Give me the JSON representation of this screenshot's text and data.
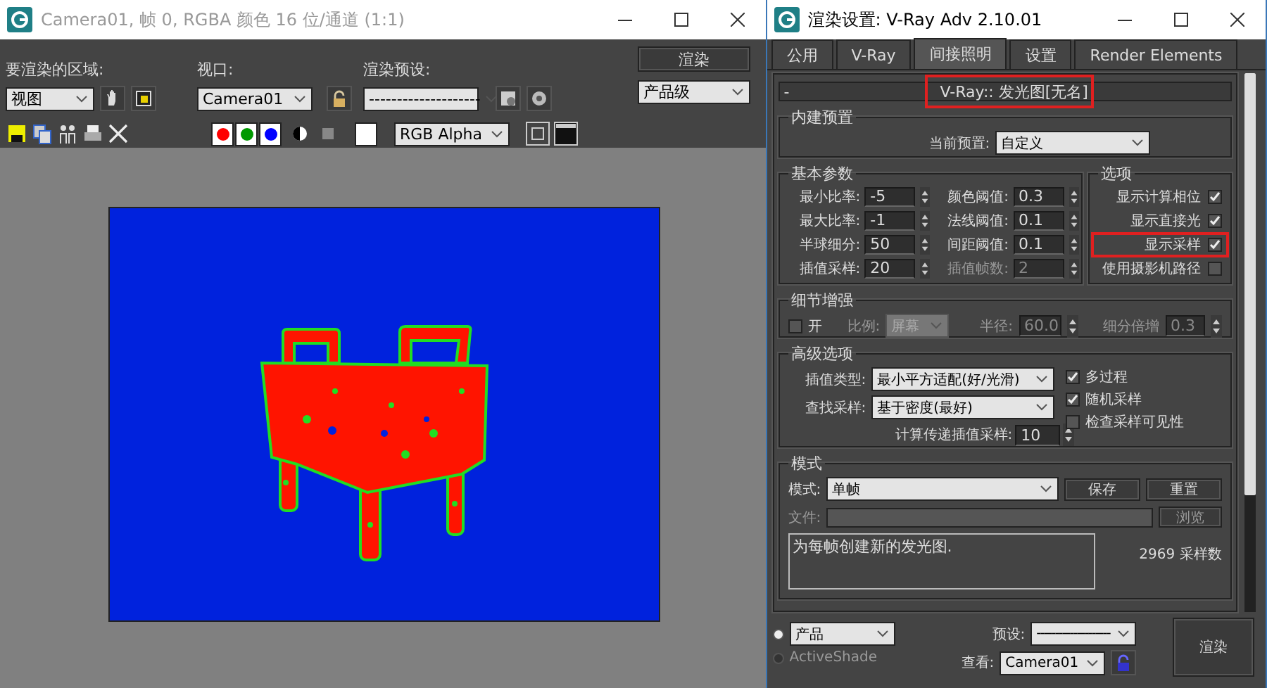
{
  "render_window": {
    "title": "Camera01, 帧 0, RGBA 颜色 16 位/通道 (1:1)",
    "area_label": "要渲染的区域:",
    "area_value": "视图",
    "viewport_label": "视口:",
    "viewport_value": "Camera01",
    "preset_label": "渲染预设:",
    "preset_value": "--------------------",
    "render_button": "渲染",
    "quality_value": "产品级",
    "channels": [
      {
        "color": "#ff0000"
      },
      {
        "color": "#009900"
      },
      {
        "color": "#0000ff"
      }
    ],
    "display_channel": "RGB Alpha"
  },
  "settings_window": {
    "title": "渲染设置: V-Ray Adv 2.10.01",
    "tabs": [
      {
        "label": "公用",
        "selected": false
      },
      {
        "label": "V-Ray",
        "selected": false
      },
      {
        "label": "间接照明",
        "selected": true
      },
      {
        "label": "设置",
        "selected": false
      },
      {
        "label": "Render Elements",
        "selected": false
      }
    ],
    "rollout": {
      "toggle": "-",
      "title": "V-Ray:: 发光图[无名]",
      "highlighted": true
    },
    "builtin_presets": {
      "title": "内建预置",
      "label": "当前预置:",
      "value": "自定义"
    },
    "basic_params": {
      "title": "基本参数",
      "left_fields": [
        {
          "label": "最小比率:",
          "value": "-5",
          "disabled": false
        },
        {
          "label": "最大比率:",
          "value": "-1",
          "disabled": false
        },
        {
          "label": "半球细分:",
          "value": "50",
          "disabled": false
        },
        {
          "label": "插值采样:",
          "value": "20",
          "disabled": false
        }
      ],
      "right_fields": [
        {
          "label": "颜色阈值:",
          "value": "0.3",
          "disabled": false
        },
        {
          "label": "法线阈值:",
          "value": "0.1",
          "disabled": false
        },
        {
          "label": "间距阈值:",
          "value": "0.1",
          "disabled": false
        },
        {
          "label": "插值帧数:",
          "value": "2",
          "disabled": true
        }
      ]
    },
    "options": {
      "title": "选项",
      "items": [
        {
          "label": "显示计算相位",
          "checked": true,
          "highlighted": false
        },
        {
          "label": "显示直接光",
          "checked": true,
          "highlighted": false
        },
        {
          "label": "显示采样",
          "checked": true,
          "highlighted": true
        },
        {
          "label": "使用摄影机路径",
          "checked": false,
          "highlighted": false
        }
      ]
    },
    "detail": {
      "title": "细节增强",
      "on_label": "开",
      "on_checked": false,
      "scale_label": "比例:",
      "scale_value": "屏幕",
      "radius_label": "半径:",
      "radius_value": "60.0",
      "subdiv_label": "细分倍增",
      "subdiv_value": "0.3"
    },
    "advanced": {
      "title": "高级选项",
      "interp_label": "插值类型:",
      "interp_value": "最小平方适配(好/光滑)",
      "lookup_label": "查找采样:",
      "lookup_value": "基于密度(最好)",
      "calc_label": "计算传递插值采样:",
      "calc_value": "10",
      "checks": [
        {
          "label": "多过程",
          "checked": true
        },
        {
          "label": "随机采样",
          "checked": true
        },
        {
          "label": "检查采样可见性",
          "checked": false
        }
      ]
    },
    "mode": {
      "title": "模式",
      "mode_label": "模式:",
      "mode_value": "单帧",
      "save_button": "保存",
      "reset_button": "重置",
      "file_label": "文件:",
      "browse_button": "浏览",
      "description": "为每帧创建新的发光图.",
      "samples": "2969 采样数"
    },
    "footer": {
      "targets": [
        {
          "label": "产品",
          "kind": "dropdown",
          "selected": true
        },
        {
          "label": "ActiveShade",
          "kind": "text",
          "selected": false
        }
      ],
      "preset_label": "预设:",
      "preset_value": "--------------------",
      "view_label": "查看:",
      "view_value": "Camera01",
      "render_button": "渲染"
    }
  }
}
